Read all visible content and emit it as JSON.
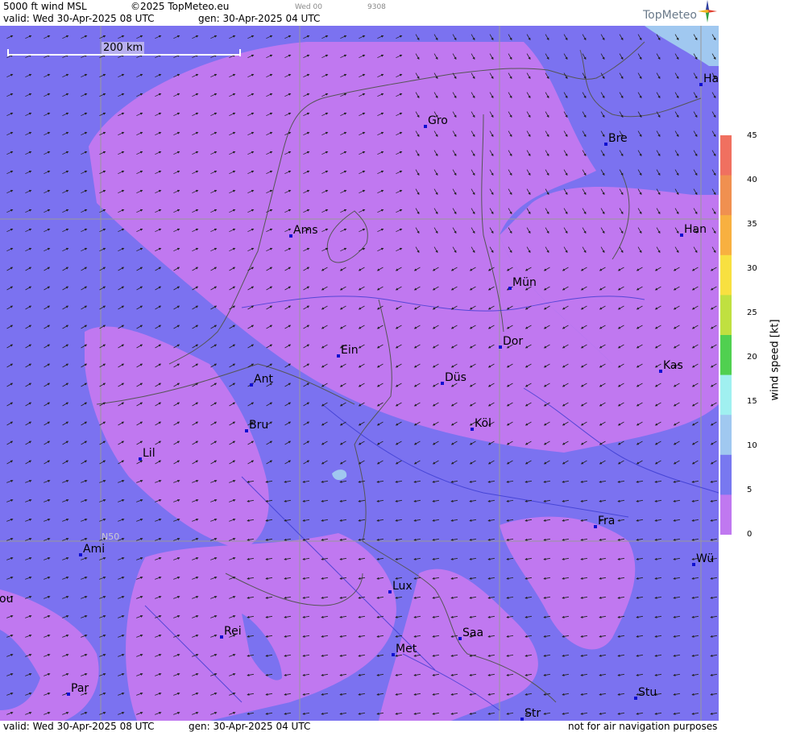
{
  "header": {
    "title": "5000 ft wind MSL",
    "copyright": "©2025 TopMeteo.eu",
    "valid": "valid:  Wed  30-Apr-2025  08 UTC",
    "gen": "gen: 30-Apr-2025 04 UTC",
    "small_day": "Wed 00",
    "small_code": "9308",
    "logo": "TopMeteo"
  },
  "footer": {
    "valid": "valid:  Wed  30-Apr-2025  08 UTC",
    "gen": "gen: 30-Apr-2025 04 UTC",
    "notice": "not for air navigation purposes"
  },
  "scale": {
    "label": "200 km"
  },
  "grid_label": "N50",
  "colorbar": {
    "label": "wind  speed  [kt]",
    "ticks": [
      "45",
      "40",
      "35",
      "30",
      "25",
      "20",
      "15",
      "10",
      "5",
      "0"
    ],
    "colors": [
      "#f07060",
      "#f09050",
      "#f8b040",
      "#f8e040",
      "#c0e040",
      "#50d050",
      "#a0f0f0",
      "#a0c8f0",
      "#7878f0",
      "#c078f0"
    ]
  },
  "cities": [
    {
      "name": "Gro"
    },
    {
      "name": "Bre"
    },
    {
      "name": "Ha"
    },
    {
      "name": "Ams"
    },
    {
      "name": "Han"
    },
    {
      "name": "Mün"
    },
    {
      "name": "Ein"
    },
    {
      "name": "Dor"
    },
    {
      "name": "Ant"
    },
    {
      "name": "Düs"
    },
    {
      "name": "Kas"
    },
    {
      "name": "Bru"
    },
    {
      "name": "Köl"
    },
    {
      "name": "Lil"
    },
    {
      "name": "Fra"
    },
    {
      "name": "Ami"
    },
    {
      "name": "Wü"
    },
    {
      "name": "Lux"
    },
    {
      "name": "ou"
    },
    {
      "name": "Rei"
    },
    {
      "name": "Saa"
    },
    {
      "name": "Met"
    },
    {
      "name": "Par"
    },
    {
      "name": "Stu"
    },
    {
      "name": "Str"
    }
  ]
}
